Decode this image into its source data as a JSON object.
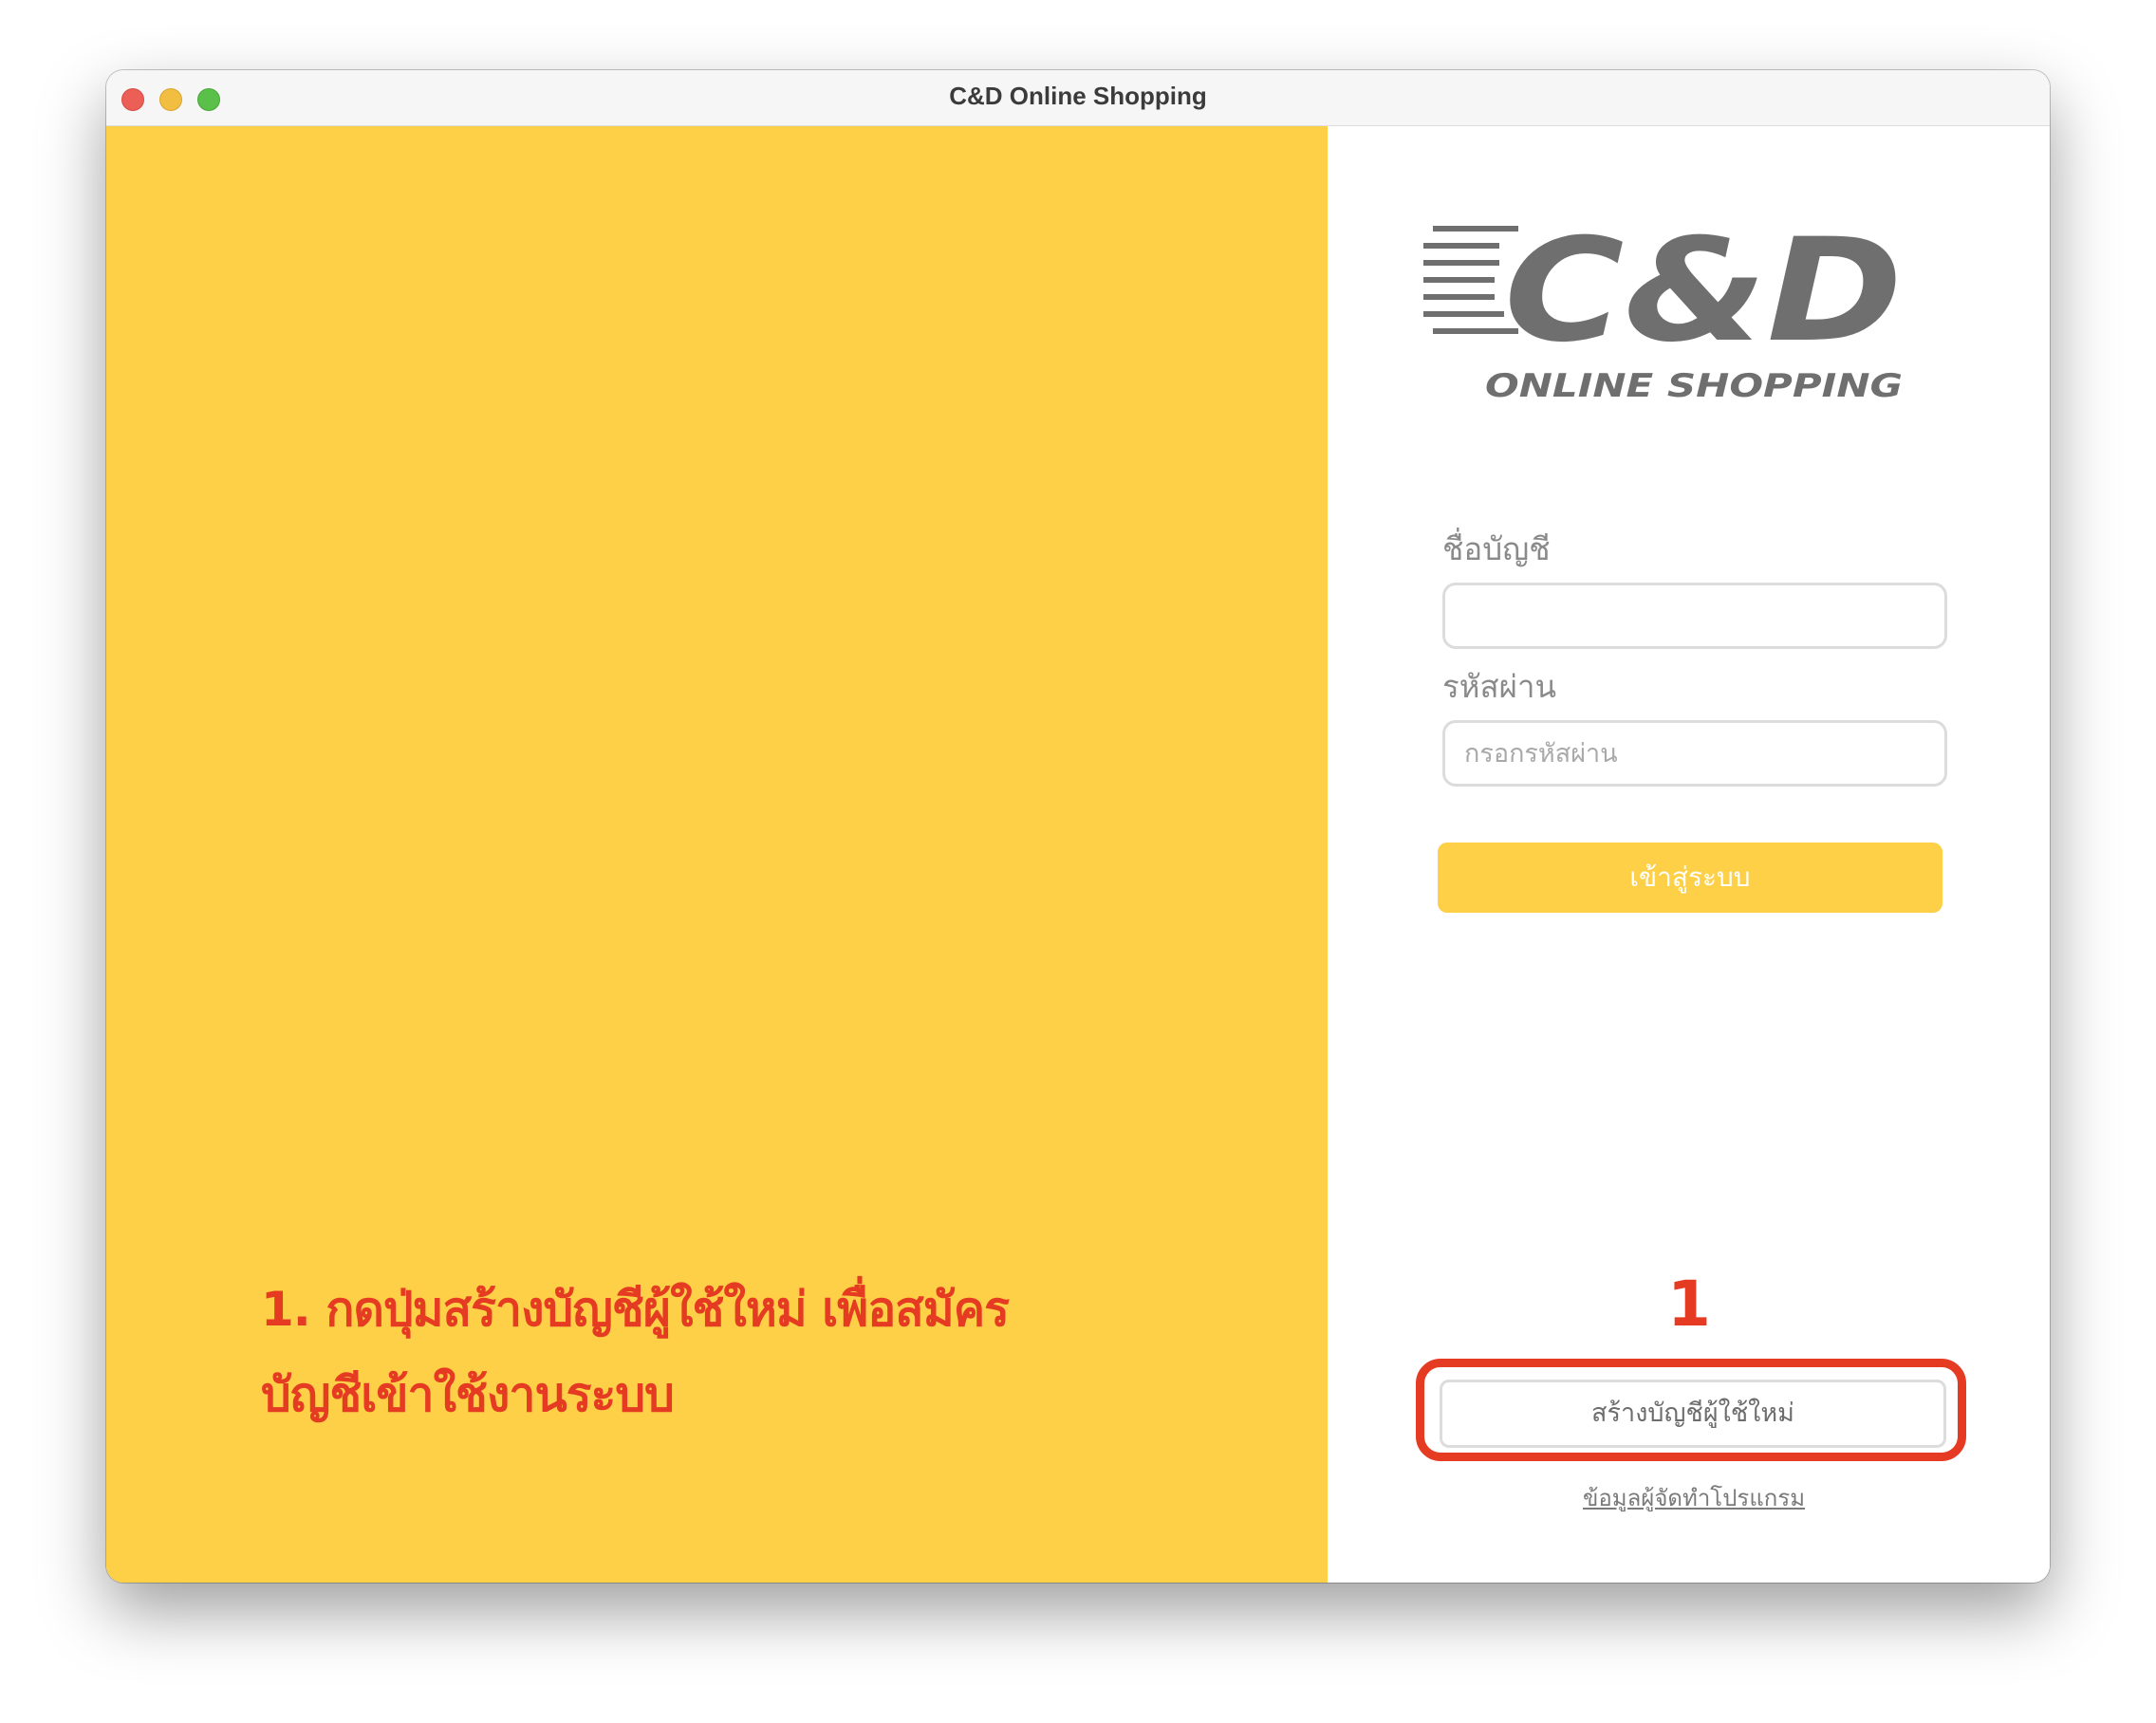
{
  "window": {
    "title": "C&D Online Shopping"
  },
  "logo": {
    "main": "C&D",
    "sub": "ONLINE SHOPPING",
    "color": "#6f6f6f"
  },
  "login_form": {
    "username_label": "ชื่อบัญชี",
    "username_value": "",
    "password_label": "รหัสผ่าน",
    "password_placeholder": "กรอกรหัสผ่าน",
    "login_button": "เข้าสู่ระบบ"
  },
  "annotation": {
    "step_number": "1",
    "instruction_line1": "1. กดปุ่มสร้างบัญชีผู้ใช้ใหม่ เพื่อสมัคร",
    "instruction_line2": "บัญชีเข้าใช้งานระบบ"
  },
  "footer": {
    "create_account_button": "สร้างบัญชีผู้ใช้ใหม่",
    "developer_info_link": "ข้อมูลผู้จัดทำโปรแกรม"
  },
  "colors": {
    "accent_yellow": "#fdd047",
    "annotation_red": "#e53b23",
    "label_gray": "#8a8a8a"
  }
}
